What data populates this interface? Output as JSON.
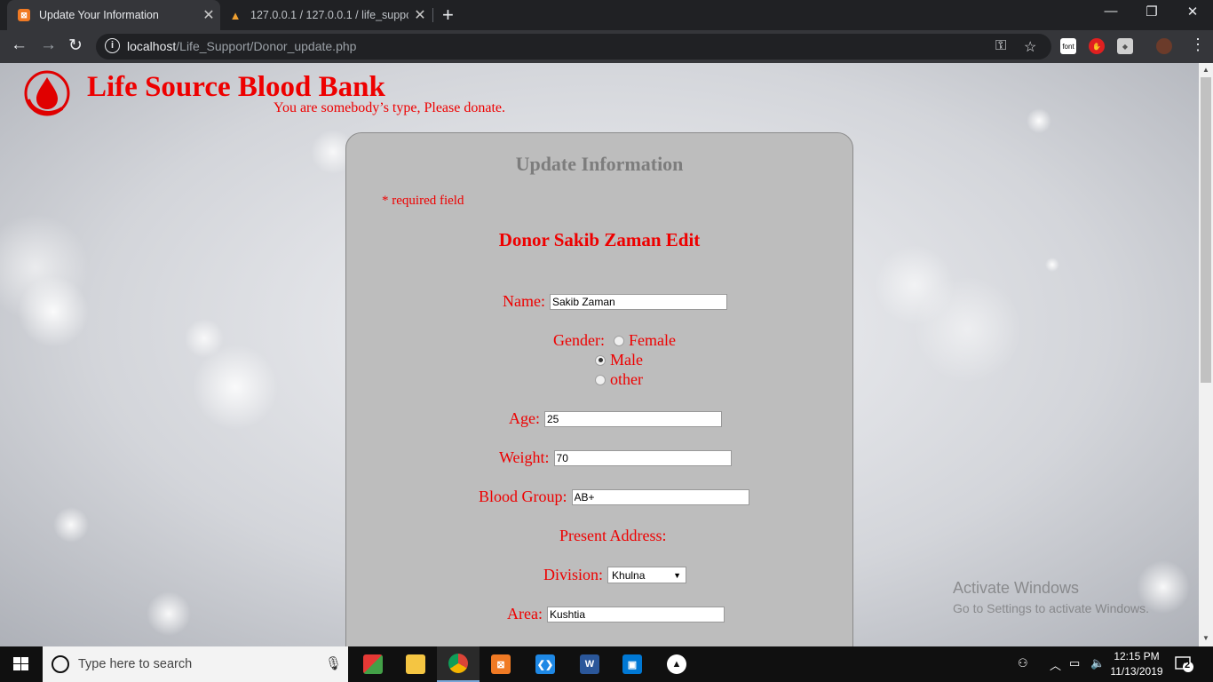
{
  "browser": {
    "tabs": [
      {
        "title": "Update Your Information",
        "favicon": "xampp-icon"
      },
      {
        "title": "127.0.0.1 / 127.0.0.1 / life_suppor",
        "favicon": "phpmyadmin-icon"
      }
    ],
    "url_host": "localhost",
    "url_path": "/Life_Support/Donor_update.php",
    "extension_font_label": "font"
  },
  "site": {
    "title": "Life Source Blood Bank",
    "tagline": "You are somebody’s type, Please donate."
  },
  "form": {
    "heading": "Update Information",
    "required_note": "* required field",
    "donor_edit_title": "Donor Sakib Zaman Edit",
    "name_label": "Name:",
    "name_value": "Sakib Zaman",
    "gender_label": "Gender:",
    "gender_options": [
      "Female",
      "Male",
      "other"
    ],
    "gender_selected": "Male",
    "age_label": "Age:",
    "age_value": "25",
    "weight_label": "Weight:",
    "weight_value": "70",
    "blood_group_label": "Blood Group:",
    "blood_group_value": "AB+",
    "present_address_label": "Present Address:",
    "division_label": "Division:",
    "division_value": "Khulna",
    "area_label": "Area:",
    "area_value": "Kushtia"
  },
  "watermark": {
    "line1": "Activate Windows",
    "line2": "Go to Settings to activate Windows."
  },
  "taskbar": {
    "search_placeholder": "Type here to search",
    "time": "12:15 PM",
    "date": "11/13/2019",
    "notification_count": "2"
  },
  "colors": {
    "brand_red": "#ee0000",
    "card_bg": "#bdbdbd",
    "chrome_dark": "#202124"
  }
}
